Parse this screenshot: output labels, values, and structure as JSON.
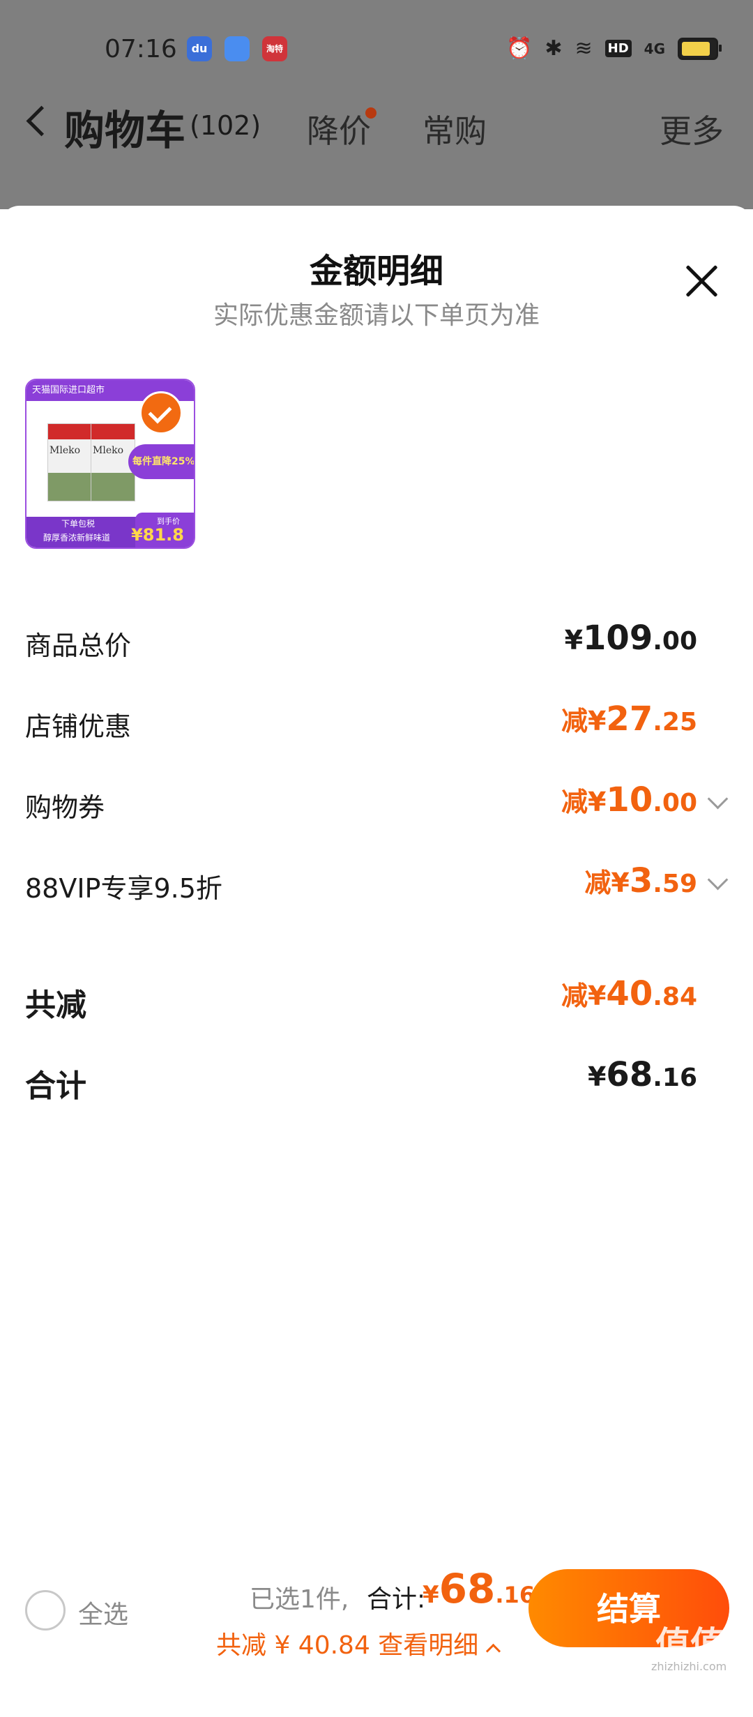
{
  "status_bar": {
    "time": "07:16",
    "app_icons": [
      "baidu-app-icon",
      "cloud-app-icon",
      "taote-app-icon"
    ],
    "app_icon_text": [
      "du",
      "",
      "淘特"
    ],
    "hd_label": "HD",
    "network": "4G"
  },
  "nav": {
    "title": "购物车",
    "count": "(102)",
    "tabs": [
      {
        "label": "降价",
        "has_dot": true
      },
      {
        "label": "常购",
        "has_dot": false
      },
      {
        "label": "更多",
        "has_dot": false
      }
    ]
  },
  "sheet": {
    "title": "金额明细",
    "subtitle": "实际优惠金额请以下单页为准",
    "product": {
      "top_band": "天猫国际进口超市",
      "brand": "Mleko",
      "promo": "每件直降25%",
      "bottom_line1": "下单包税",
      "bottom_line2": "醇厚香浓新鲜味道",
      "price_label": "到手价",
      "price": "¥81.8",
      "selected": true
    },
    "rows": [
      {
        "label": "商品总价",
        "prefix": "",
        "symbol": "¥",
        "int": "109",
        "cents": ".00",
        "color": "dark",
        "expandable": false
      },
      {
        "label": "店铺优惠",
        "prefix": "减",
        "symbol": "¥",
        "int": "27",
        "cents": ".25",
        "color": "orange",
        "expandable": false
      },
      {
        "label": "购物券",
        "prefix": "减",
        "symbol": "¥",
        "int": "10",
        "cents": ".00",
        "color": "orange",
        "expandable": true
      },
      {
        "label": "88VIP专享9.5折",
        "prefix": "减",
        "symbol": "¥",
        "int": "3",
        "cents": ".59",
        "color": "orange",
        "expandable": true
      }
    ],
    "summary": [
      {
        "label": "共减",
        "prefix": "减",
        "symbol": "¥",
        "int": "40",
        "cents": ".84",
        "color": "orange"
      },
      {
        "label": "合计",
        "prefix": "",
        "symbol": "¥",
        "int": "68",
        "cents": ".16",
        "color": "dark"
      }
    ]
  },
  "bottom_bar": {
    "select_all": "全选",
    "selected_count": "已选1件,",
    "total_label": "合计:",
    "total_symbol": "¥",
    "total_int": "68",
    "total_cents": ".16",
    "saved_text": "共减 ¥ 40.84 查看明细",
    "checkout_label": "结算"
  },
  "watermark": {
    "text": "值值值",
    "url": "zhizhizhi.com"
  },
  "colors": {
    "accent": "#f2620f",
    "overlay": "#7f7f7f",
    "checkout_start": "#ff8a00",
    "checkout_end": "#ff4d0a"
  }
}
